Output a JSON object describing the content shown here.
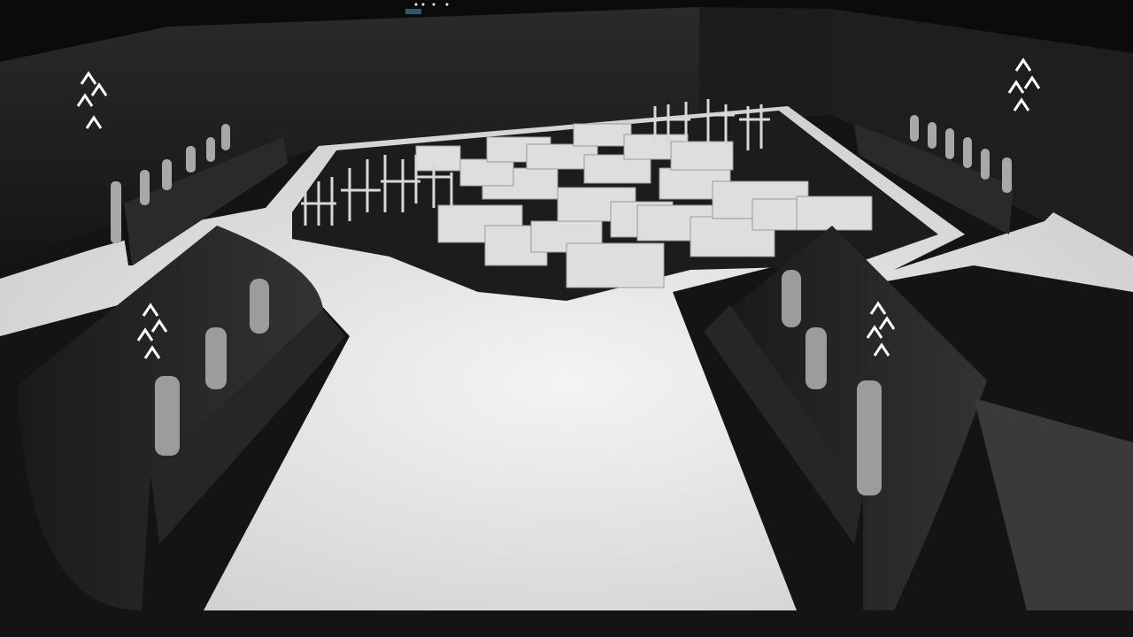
{
  "scene": {
    "kind": "3d-render",
    "description_visible_text": [],
    "colors": {
      "background": "#0b0b0b",
      "wall": "#202020",
      "floor_light": "#e8e8e8",
      "floor_dark": "#161616",
      "furniture": "#dcdcdc",
      "figure": "#9a9a9a",
      "logo": "#ffffff"
    },
    "icons": [
      "logo-mark-icon"
    ]
  }
}
